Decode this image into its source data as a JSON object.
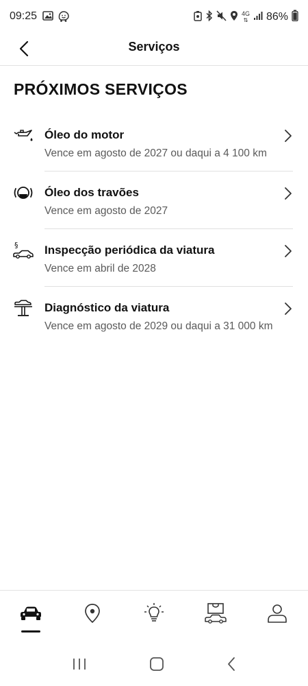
{
  "status_bar": {
    "time": "09:25",
    "battery": "86%",
    "network": "4G",
    "left_icons": [
      "gallery-icon",
      "waze-icon"
    ],
    "right_icons": [
      "lock-battery-icon",
      "bluetooth-icon",
      "mute-icon",
      "location-icon",
      "signal-icon",
      "battery-icon"
    ]
  },
  "header": {
    "title": "Serviços",
    "back_icon": "chevron-left-icon"
  },
  "section": {
    "title": "PRÓXIMOS SERVIÇOS"
  },
  "services": [
    {
      "name": "Óleo do motor",
      "due": "Vence em agosto de 2027 ou daqui a 4 100 km",
      "icon": "engine-oil-icon"
    },
    {
      "name": "Óleo dos travões",
      "due": "Vence em agosto de 2027",
      "icon": "brake-fluid-icon"
    },
    {
      "name": "Inspecção periódica da viatura",
      "due": "Vence em abril de 2028",
      "icon": "vehicle-inspection-icon"
    },
    {
      "name": "Diagnóstico da viatura",
      "due": "Vence em agosto de 2029 ou daqui a 31 000 km",
      "icon": "vehicle-lift-icon"
    }
  ],
  "bottom_nav": {
    "active": "vehicle",
    "items": [
      "car-icon",
      "map-pin-icon",
      "lightbulb-icon",
      "shop-icon",
      "profile-icon"
    ]
  },
  "system_nav": [
    "recent-apps-icon",
    "home-icon",
    "back-icon"
  ],
  "colors": {
    "text": "#111111",
    "subtext": "#5a5a5a",
    "divider": "#e0e0e0",
    "background": "#ffffff"
  }
}
